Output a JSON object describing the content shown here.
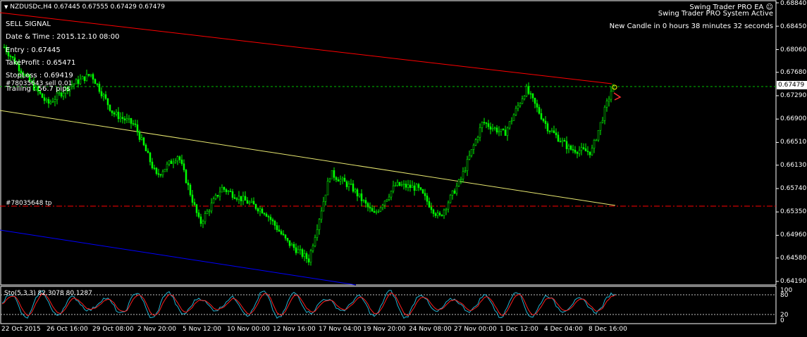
{
  "header": {
    "symbol_line": "NZDUSDc,H4  0.67445 0.67555 0.67429 0.67479"
  },
  "ea_panel": {
    "title": "Swing Trader PRO EA",
    "status": "Swing Trader PRO System Active",
    "candle_timer": "New Candle in 0 hours 38 minutes 32 seconds"
  },
  "signal": {
    "type": "SELL SIGNAL",
    "datetime": "Date & Time : 2015.12.10 08:00",
    "entry": "Entry : 0.67445",
    "take_profit": "TakeProfit : 0.65471",
    "stop_loss": "StopLoss : 0.69419",
    "order": "#78035643 sell 0.01",
    "trailing": "Trailing : 56.7 pips",
    "tp_label": "#78035648 tp"
  },
  "colors": {
    "background": "#000000",
    "candles": "#00ff00",
    "resistance_line": "#ff0000",
    "mid_line": "#ffff66",
    "support_line": "#0000ff",
    "tp_line": "#ff0000",
    "entry_line": "#00ff00",
    "stoch_main": "#00bcd4",
    "stoch_signal": "#ff0000"
  },
  "price_axis": {
    "ticks": [
      "0.68840",
      "0.68450",
      "0.68060",
      "0.67680",
      "0.67290",
      "0.66900",
      "0.66510",
      "0.66130",
      "0.65740",
      "0.65350",
      "0.64960",
      "0.64580",
      "0.64190"
    ],
    "current_price": "0.67479"
  },
  "time_axis": {
    "ticks": [
      "22 Oct 2015",
      "26 Oct 16:00",
      "29 Oct 08:00",
      "2 Nov 20:00",
      "5 Nov 12:00",
      "10 Nov 00:00",
      "12 Nov 16:00",
      "17 Nov 04:00",
      "19 Nov 20:00",
      "24 Nov 08:00",
      "27 Nov 00:00",
      "1 Dec 12:00",
      "4 Dec 04:00",
      "8 Dec 16:00"
    ]
  },
  "stochastic": {
    "label": "Sto(5,3,3) 82.3078 80.1287",
    "ticks": [
      "100",
      "80",
      "20",
      "0"
    ]
  },
  "chart_data": {
    "type": "candlestick",
    "title": "NZDUSDc,H4",
    "ylim": [
      0.6419,
      0.6884
    ],
    "x": [
      "22 Oct 2015",
      "26 Oct 16:00",
      "29 Oct 08:00",
      "2 Nov 20:00",
      "5 Nov 12:00",
      "10 Nov 00:00",
      "12 Nov 16:00",
      "17 Nov 04:00",
      "19 Nov 20:00",
      "24 Nov 08:00",
      "27 Nov 00:00",
      "1 Dec 12:00",
      "4 Dec 04:00",
      "8 Dec 16:00"
    ],
    "close_path": [
      0.681,
      0.676,
      0.6715,
      0.6745,
      0.6765,
      0.67,
      0.668,
      0.6595,
      0.663,
      0.6515,
      0.6575,
      0.6555,
      0.6535,
      0.6485,
      0.6455,
      0.66,
      0.6575,
      0.653,
      0.658,
      0.6575,
      0.6525,
      0.659,
      0.6685,
      0.6665,
      0.674,
      0.6675,
      0.664,
      0.6635,
      0.6748
    ],
    "last": {
      "open": 0.67445,
      "high": 0.67555,
      "low": 0.67429,
      "close": 0.67479
    },
    "levels": {
      "entry": 0.67445,
      "take_profit": 0.65471,
      "stop_loss": 0.69419
    },
    "stochastic": {
      "k": 82.3078,
      "d": 80.1287,
      "levels": [
        80,
        20
      ],
      "range": [
        0,
        100
      ]
    }
  }
}
